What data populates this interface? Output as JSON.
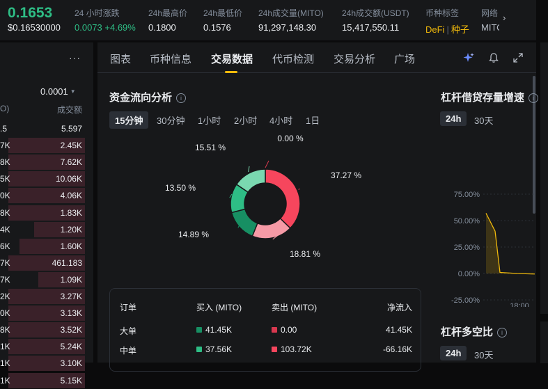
{
  "ticker": {
    "price": "0.1653",
    "price_usd": "$0.16530000"
  },
  "stats": [
    {
      "label": "24 小时涨跌",
      "change": "0.0073",
      "change_pct": "+4.69%"
    },
    {
      "label": "24h最高价",
      "value": "0.1800"
    },
    {
      "label": "24h最低价",
      "value": "0.1576"
    },
    {
      "label": "24h成交量(MITO)",
      "value": "91,297,148.30"
    },
    {
      "label": "24h成交额(USDT)",
      "value": "15,417,550.11"
    },
    {
      "label": "币种标签",
      "value": "DeFi",
      "value2": "种子"
    },
    {
      "label": "网络",
      "value": "MITO"
    }
  ],
  "orderbook": {
    "precision": "0.0001",
    "header_left": "O)",
    "header_right": "成交额",
    "rows": [
      {
        "left": ".5",
        "right": "5.597",
        "depth": 0.0
      },
      {
        "left": "7K",
        "right": "2.45K",
        "depth": 0.9
      },
      {
        "left": "8K",
        "right": "7.62K",
        "depth": 0.9
      },
      {
        "left": "5K",
        "right": "10.06K",
        "depth": 0.9
      },
      {
        "left": "0K",
        "right": "4.06K",
        "depth": 0.9
      },
      {
        "left": "8K",
        "right": "1.83K",
        "depth": 0.9
      },
      {
        "left": "4K",
        "right": "1.20K",
        "depth": 0.6
      },
      {
        "left": "6K",
        "right": "1.60K",
        "depth": 0.77
      },
      {
        "left": "7K",
        "right": "461.183",
        "depth": 0.9
      },
      {
        "left": "7K",
        "right": "1.09K",
        "depth": 0.55
      },
      {
        "left": "2K",
        "right": "3.27K",
        "depth": 0.9
      },
      {
        "left": "0K",
        "right": "3.13K",
        "depth": 0.9
      },
      {
        "left": "8K",
        "right": "3.52K",
        "depth": 0.9
      },
      {
        "left": "1K",
        "right": "5.24K",
        "depth": 0.9
      },
      {
        "left": "1K",
        "right": "3.10K",
        "depth": 0.9
      },
      {
        "left": "1K",
        "right": "5.15K",
        "depth": 0.9
      }
    ]
  },
  "tabs": [
    "图表",
    "币种信息",
    "交易数据",
    "代币检测",
    "交易分析",
    "广场"
  ],
  "active_tab": "交易数据",
  "fund_flow": {
    "title": "资金流向分析",
    "periods": [
      "15分钟",
      "30分钟",
      "1小时",
      "2小时",
      "4小时",
      "1日"
    ],
    "active_period": "15分钟",
    "slices": [
      {
        "label": "0.00 %",
        "value": 0.0,
        "color": "#d8384f"
      },
      {
        "label": "37.27 %",
        "value": 37.27,
        "color": "#f6465d"
      },
      {
        "label": "18.81 %",
        "value": 18.81,
        "color": "#f69aa6"
      },
      {
        "label": "14.89 %",
        "value": 14.89,
        "color": "#178f63"
      },
      {
        "label": "13.50 %",
        "value": 13.5,
        "color": "#2ebd85"
      },
      {
        "label": "15.51 %",
        "value": 15.51,
        "color": "#7ad8b0"
      }
    ],
    "table": {
      "headers": [
        "订单",
        "买入 (MITO)",
        "卖出 (MITO)",
        "净流入"
      ],
      "rows": [
        {
          "type": "大单",
          "buy": "41.45K",
          "sell": "0.00",
          "net": "41.45K",
          "buy_color": "#178f63",
          "sell_color": "#d8384f"
        },
        {
          "type": "中单",
          "buy": "37.56K",
          "sell": "103.72K",
          "net": "-66.16K",
          "buy_color": "#2ebd85",
          "sell_color": "#f6465d"
        }
      ]
    }
  },
  "margin_growth": {
    "title": "杠杆借贷存量增速",
    "periods": [
      "24h",
      "30天"
    ],
    "active_period": "24h",
    "y_ticks": [
      "75.00%",
      "50.00%",
      "25.00%",
      "0.00%",
      "-25.00%"
    ],
    "x_tick": "18:00",
    "ylim": [
      -25,
      75
    ],
    "series": [
      57,
      40,
      1,
      0,
      -0.5
    ],
    "line_color": "#f0b90b"
  },
  "long_short": {
    "title": "杠杆多空比",
    "periods": [
      "24h",
      "30天"
    ],
    "active_period": "24h"
  }
}
